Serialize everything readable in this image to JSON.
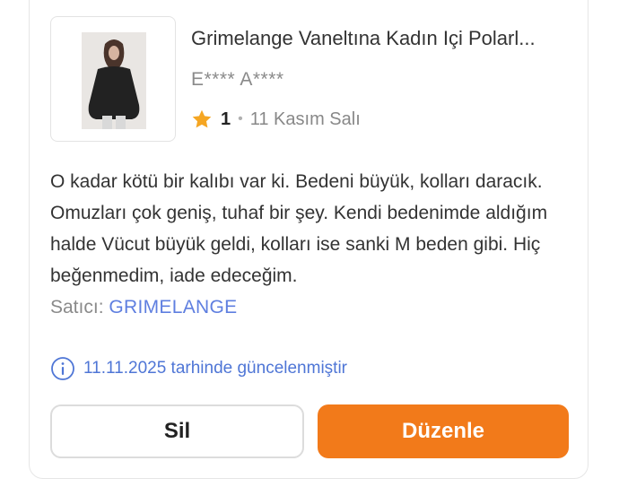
{
  "product": {
    "title": "Grimelange Vaneltına Kadın Içi Polarl...",
    "image_icon": "product-photo-sweatshirt"
  },
  "review": {
    "reviewer": "E**** A****",
    "rating": "1",
    "date": "11 Kasım Salı",
    "comment_lines": [
      "O kadar kötü bir kalıbı var ki. Bedeni büyük, kolları daracık.",
      "Omuzları çok geniş, tuhaf bir şey. Kendi bedenimde aldığım",
      "halde Vücut büyük geldi, kolları ise sanki M beden gibi. Hiç",
      "beğenmedim, iade edeceğim."
    ]
  },
  "seller": {
    "label": "Satıcı:",
    "name": "GRIMELANGE"
  },
  "update_note": "11.11.2025 tarhinde güncelenmiştir",
  "actions": {
    "delete_label": "Sil",
    "edit_label": "Düzenle"
  },
  "colors": {
    "accent_orange": "#f27a1a",
    "seller_blue": "#5f7fe0",
    "info_blue": "#4f76d6",
    "star": "#f5a623"
  }
}
